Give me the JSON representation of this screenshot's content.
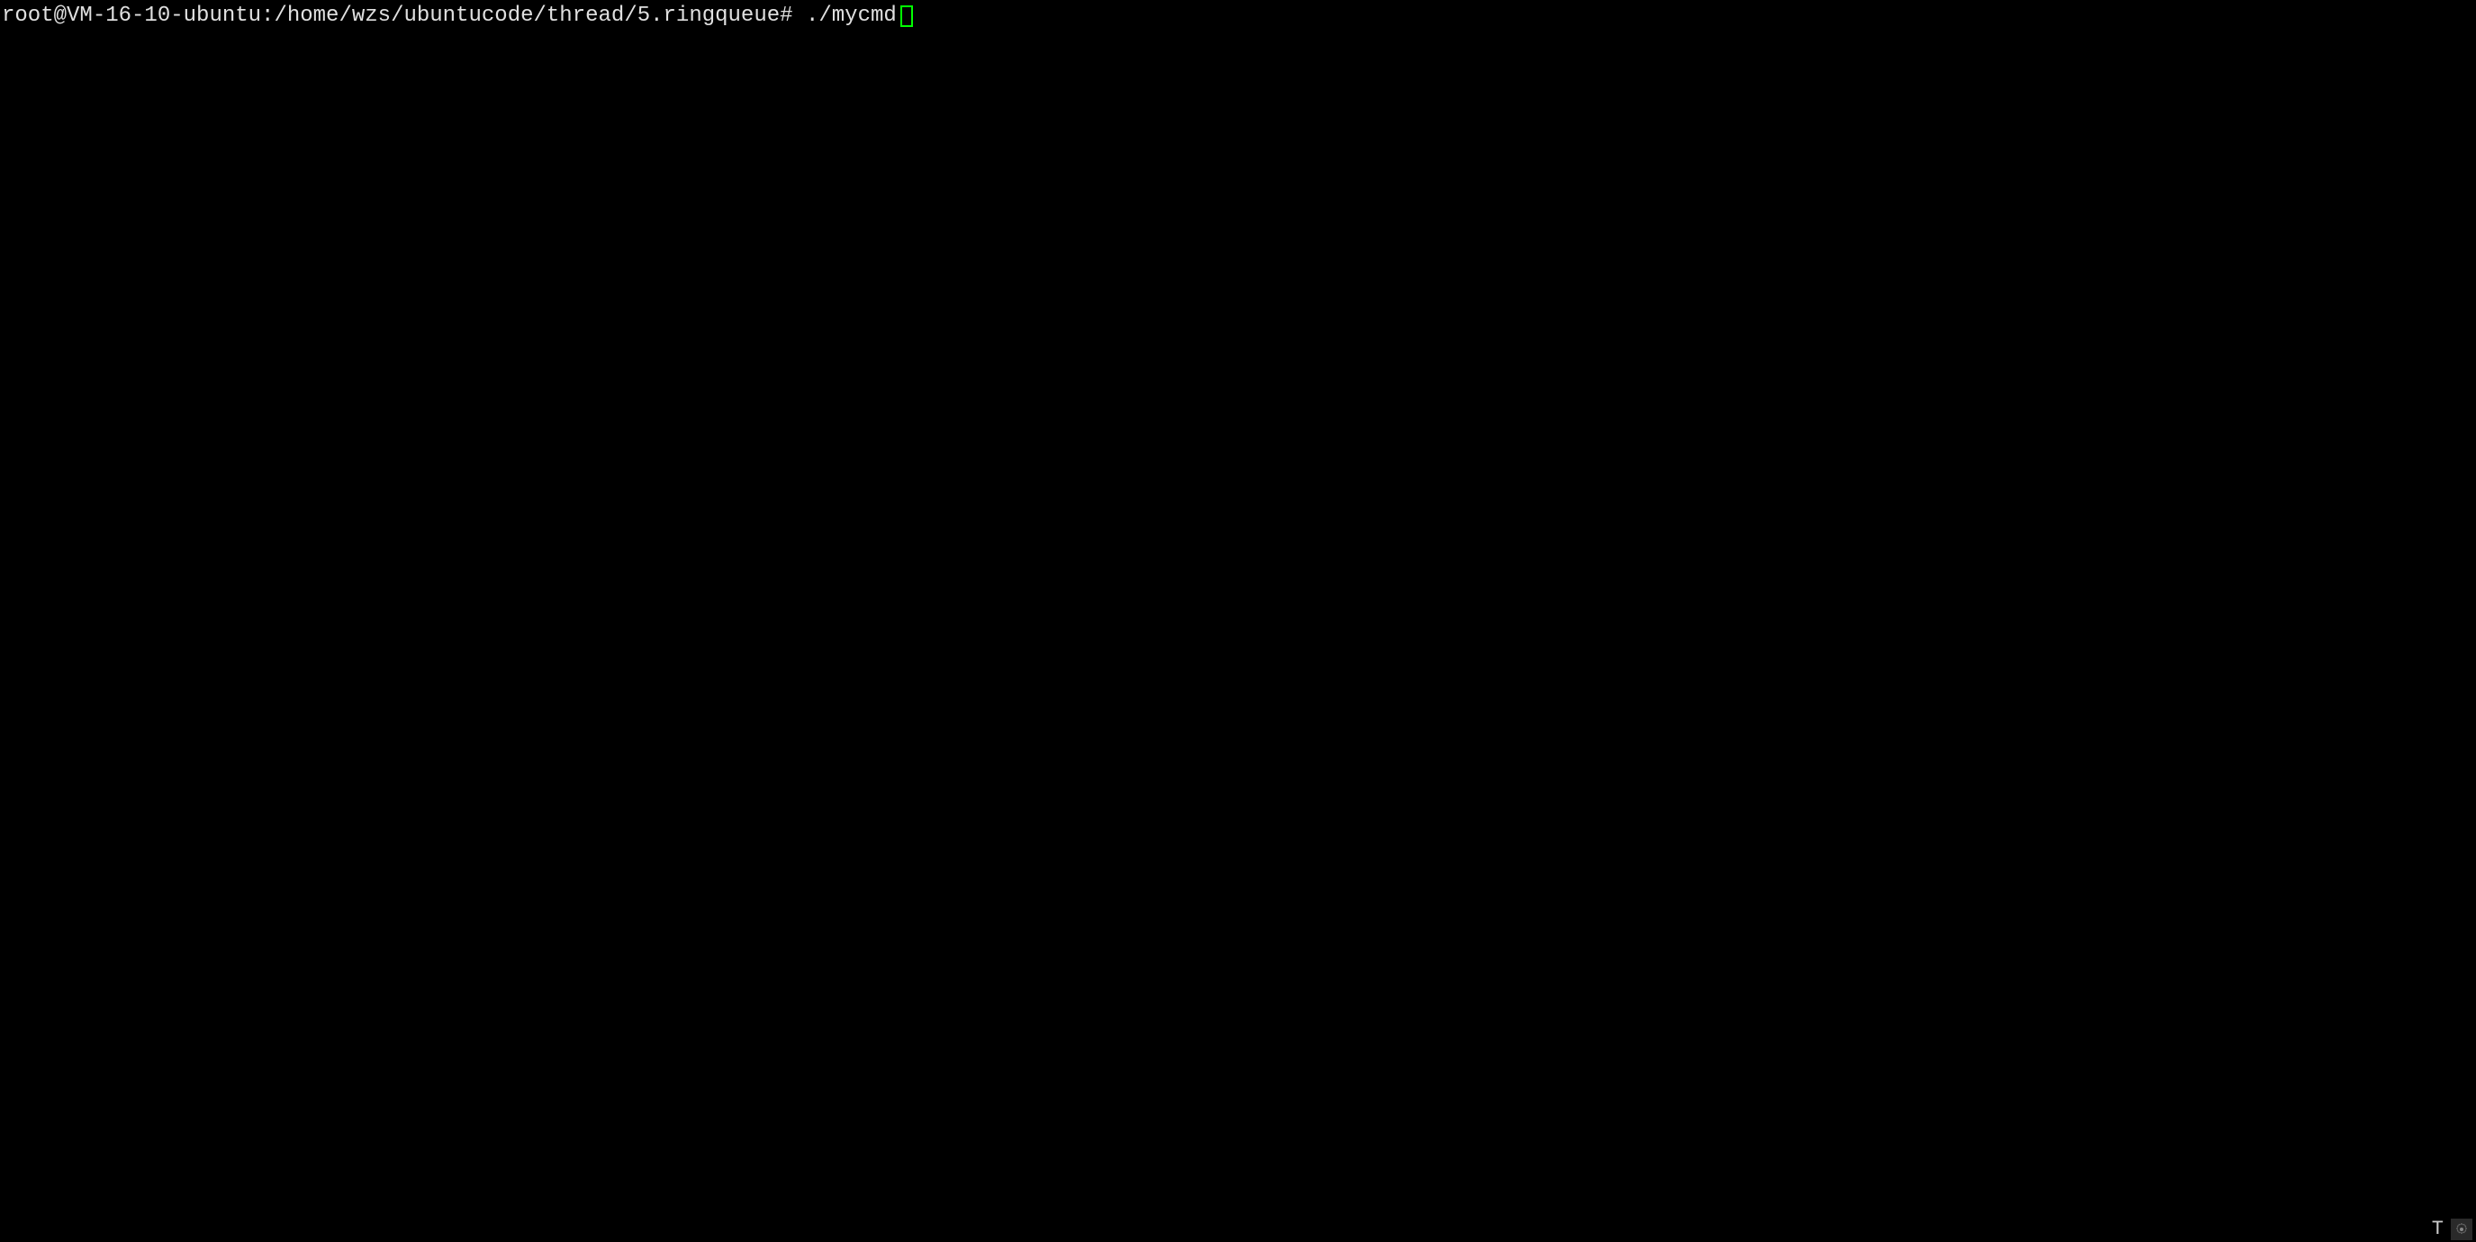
{
  "terminal": {
    "prompt": "root@VM-16-10-ubuntu:/home/wzs/ubuntucode/thread/5.ringqueue# ",
    "command": "./mycmd"
  },
  "status": {
    "text": "T"
  }
}
